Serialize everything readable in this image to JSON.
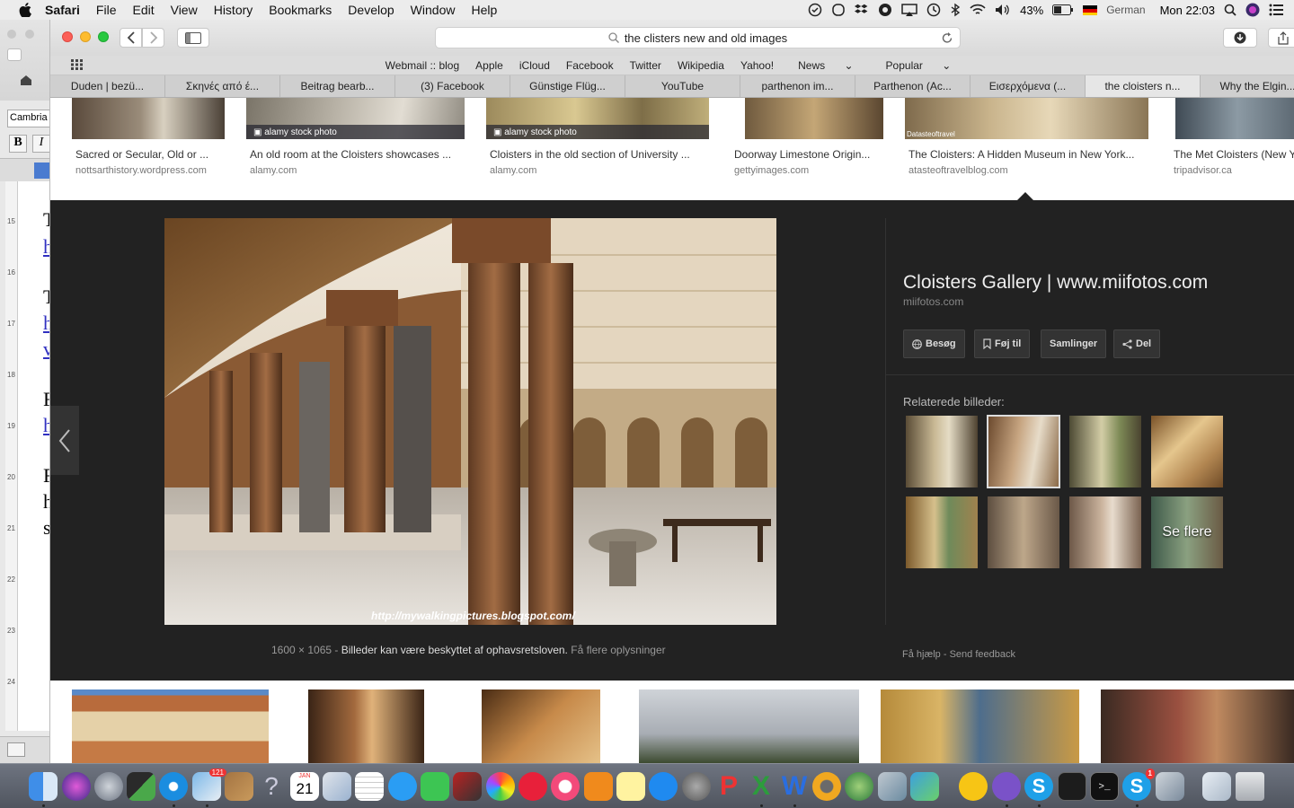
{
  "menubar": {
    "app": "Safari",
    "items": [
      "File",
      "Edit",
      "View",
      "History",
      "Bookmarks",
      "Develop",
      "Window",
      "Help"
    ],
    "battery": "43%",
    "input_source": "German",
    "clock": "Mon 22:03"
  },
  "word": {
    "font": "Cambria",
    "bold": "B",
    "italic": "I",
    "ruler": [
      "15",
      "16",
      "17",
      "18",
      "19",
      "20",
      "21",
      "22",
      "23",
      "24"
    ],
    "letters": [
      "T",
      "h",
      "T",
      "h",
      "v",
      "F",
      "h",
      "F",
      "h",
      "s"
    ]
  },
  "toolbar": {
    "url": "the clisters new and old images"
  },
  "favorites": [
    "Webmail :: blog",
    "Apple",
    "iCloud",
    "Facebook",
    "Twitter",
    "Wikipedia",
    "Yahoo!",
    "News",
    "Popular"
  ],
  "tabs": [
    "Duden | bezü...",
    "Σκηνές από έ...",
    "Beitrag bearb...",
    "(3) Facebook",
    "Günstige Flüg...",
    "YouTube",
    "parthenon im...",
    "Parthenon (Ac...",
    "Εισερχόμενα (...",
    "the cloisters n...",
    "Why the Elgin..."
  ],
  "active_tab_index": 9,
  "top_results": [
    {
      "caption": "Sacred or Secular, Old or ...",
      "domain": "nottsarthistory.wordpress.com",
      "badge": ""
    },
    {
      "caption": "An old room at the Cloisters showcases ...",
      "domain": "alamy.com",
      "badge": "alamy stock photo"
    },
    {
      "caption": "Cloisters in the old section of University ...",
      "domain": "alamy.com",
      "badge": "alamy stock photo"
    },
    {
      "caption": "Doorway Limestone Origin...",
      "domain": "gettyimages.com",
      "badge": ""
    },
    {
      "caption": "The Cloisters: A Hidden Museum in New York...",
      "domain": "atasteoftravelblog.com",
      "badge": "Datasteoftravel"
    },
    {
      "caption": "The Met Cloisters (New Y",
      "domain": "tripadvisor.ca",
      "badge": ""
    }
  ],
  "preview": {
    "title": "Cloisters Gallery | www.miifotos.com",
    "site": "miifotos.com",
    "watermark": "http://mywalkingpictures.blogspot.com/",
    "dimensions": "1600 × 1065",
    "copyright": "Billeder kan være beskyttet af ophavsretsloven.",
    "more_info": "Få flere oplysninger",
    "buttons": {
      "visit": "Besøg",
      "save": "Føj til",
      "collections": "Samlinger",
      "share": "Del"
    },
    "related_heading": "Relaterede billeder:",
    "see_more": "Se flere",
    "help": "Få hjælp",
    "feedback": "Send feedback"
  },
  "dock": {
    "calendar_month": "JAN",
    "calendar_day": "21",
    "mail_badge": "121",
    "skype_badge": "1"
  }
}
